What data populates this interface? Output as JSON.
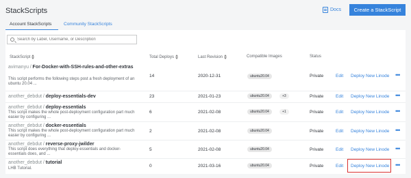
{
  "page": {
    "title": "StackScripts"
  },
  "toolbar": {
    "docs_label": "Docs",
    "create_label": "Create a StackScript"
  },
  "tabs": [
    {
      "label": "Account StackScripts",
      "active": true
    },
    {
      "label": "Community StackScripts",
      "active": false
    }
  ],
  "search": {
    "placeholder": "Search by Label, Username, or Description"
  },
  "columns": [
    "StackScript",
    "Total Deploys",
    "Last Revision",
    "Compatible Images",
    "Status"
  ],
  "rows": [
    {
      "user": "avimanyu",
      "sep": "/",
      "name": "For-Docker-with-SSH-rules-and-other-extras",
      "desc": "This script performs the following steps post a fresh deployment of an ubuntu 20.04 ...",
      "deploys": "14",
      "revision": "2020-12-31",
      "image": "ubuntu20.04",
      "extra": "",
      "status": "Private",
      "edit": "Edit",
      "deploy": "Deploy New Linode"
    },
    {
      "user": "another_debdut",
      "sep": "/",
      "name": "deploy-essentials-dev",
      "desc": "",
      "deploys": "23",
      "revision": "2021-01-23",
      "image": "ubuntu20.04",
      "extra": "+3",
      "status": "Private",
      "edit": "Edit",
      "deploy": "Deploy New Linode"
    },
    {
      "user": "another_debdut",
      "sep": "/",
      "name": "deploy-essentials",
      "desc": "This script makes the whole post-deployment configuration part much easier by configuring ...",
      "deploys": "6",
      "revision": "2021-02-08",
      "image": "ubuntu20.04",
      "extra": "+1",
      "status": "Private",
      "edit": "Edit",
      "deploy": "Deploy New Linode"
    },
    {
      "user": "another_debdut",
      "sep": "/",
      "name": "docker-essentials",
      "desc": "This script makes the whole post-deployment configuration part much easier by configuring ...",
      "deploys": "2",
      "revision": "2021-02-08",
      "image": "ubuntu20.04",
      "extra": "",
      "status": "Private",
      "edit": "Edit",
      "deploy": "Deploy New Linode"
    },
    {
      "user": "another_debdut",
      "sep": "/",
      "name": "reverse-proxy-jwilder",
      "desc": "This script does everything that deploy-essentials and docker-essentials does, and ...",
      "deploys": "5",
      "revision": "2021-02-08",
      "image": "ubuntu20.04",
      "extra": "",
      "status": "Private",
      "edit": "Edit",
      "deploy": "Deploy New Linode"
    },
    {
      "user": "another_debdut",
      "sep": "/",
      "name": "tutorial",
      "desc": "LHB Tutorial.",
      "deploys": "0",
      "revision": "2021-03-16",
      "image": "ubuntu20.04",
      "extra": "",
      "status": "Private",
      "edit": "Edit",
      "deploy": "Deploy New Linode"
    }
  ],
  "more_label": "•••",
  "colors": {
    "accent": "#3683dc",
    "highlight": "#d9302f"
  }
}
